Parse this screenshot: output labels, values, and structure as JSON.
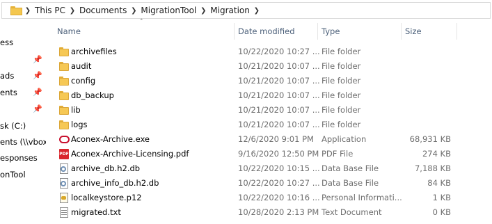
{
  "breadcrumb": [
    "This PC",
    "Documents",
    "MigrationTool",
    "Migration"
  ],
  "nav": {
    "items": [
      {
        "label": "ess",
        "pinned": false
      },
      {
        "label": "",
        "pinned": true
      },
      {
        "label": "ads",
        "pinned": true
      },
      {
        "label": "ents",
        "pinned": true
      },
      {
        "label": "",
        "pinned": true
      },
      {
        "label": "sk (C:)",
        "pinned": false
      },
      {
        "label": "ents (\\\\vbox",
        "pinned": false
      },
      {
        "label": "esponses",
        "pinned": false
      },
      {
        "label": "onTool",
        "pinned": false
      }
    ]
  },
  "columns": {
    "name": "Name",
    "date": "Date modified",
    "type": "Type",
    "size": "Size"
  },
  "files": [
    {
      "name": "archivefiles",
      "date": "10/22/2020 10:27 ...",
      "type": "File folder",
      "size": "",
      "icon": "folder-icon"
    },
    {
      "name": "audit",
      "date": "10/21/2020 10:07 ...",
      "type": "File folder",
      "size": "",
      "icon": "folder-icon"
    },
    {
      "name": "config",
      "date": "10/21/2020 10:07 ...",
      "type": "File folder",
      "size": "",
      "icon": "folder-icon"
    },
    {
      "name": "db_backup",
      "date": "10/21/2020 10:07 ...",
      "type": "File folder",
      "size": "",
      "icon": "folder-icon"
    },
    {
      "name": "lib",
      "date": "10/21/2020 10:07 ...",
      "type": "File folder",
      "size": "",
      "icon": "folder-icon"
    },
    {
      "name": "logs",
      "date": "10/21/2020 10:07 ...",
      "type": "File folder",
      "size": "",
      "icon": "folder-icon"
    },
    {
      "name": "Aconex-Archive.exe",
      "date": "12/6/2020 9:01 PM",
      "type": "Application",
      "size": "68,931 KB",
      "icon": "app-icon"
    },
    {
      "name": "Aconex-Archive-Licensing.pdf",
      "date": "9/16/2020 12:50 PM",
      "type": "PDF File",
      "size": "274 KB",
      "icon": "pdf-icon"
    },
    {
      "name": "archive_db.h2.db",
      "date": "10/22/2020 10:15 ...",
      "type": "Data Base File",
      "size": "7,188 KB",
      "icon": "db-file-icon"
    },
    {
      "name": "archive_info_db.h2.db",
      "date": "10/22/2020 10:27 ...",
      "type": "Data Base File",
      "size": "84 KB",
      "icon": "db-file-icon"
    },
    {
      "name": "localkeystore.p12",
      "date": "10/22/2020 10:16 ...",
      "type": "Personal Informati...",
      "size": "1 KB",
      "icon": "certificate-icon"
    },
    {
      "name": "migrated.txt",
      "date": "10/28/2020 2:13 PM",
      "type": "Text Document",
      "size": "0 KB",
      "icon": "text-file-icon"
    }
  ],
  "pdf_icon_text": "PDF"
}
